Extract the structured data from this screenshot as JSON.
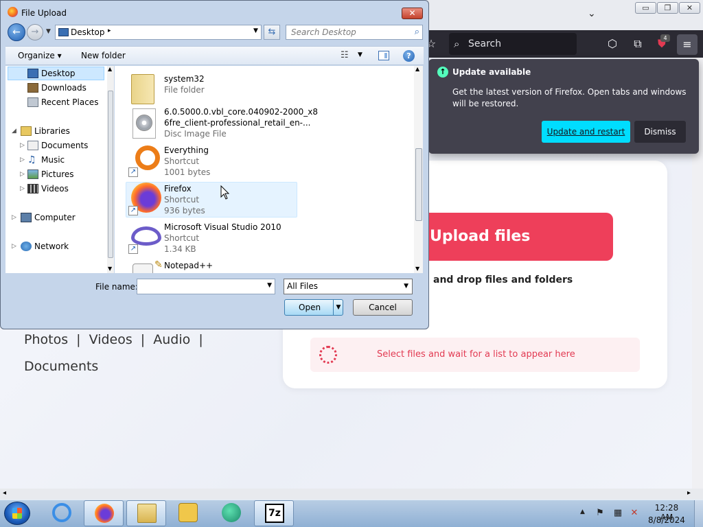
{
  "firefox": {
    "window_controls": {
      "minimize": "▭",
      "restore": "❐",
      "close": "✕"
    },
    "tab_list_chevron": "⌄",
    "search_placeholder": "Search",
    "extension_badge": "4",
    "update_popup": {
      "title": "Update available",
      "message": "Get the latest version of Firefox. Open tabs and windows will be restored.",
      "primary_button": "Update and restart",
      "secondary_button": "Dismiss",
      "accent_color": "#00ddff"
    },
    "page": {
      "upload_button": "Upload files",
      "drop_text": "and drop files and folders",
      "wait_text": "Select files and wait for a list to appear here",
      "media_links": [
        "Photos",
        "Videos",
        "Audio"
      ],
      "media_links_row2": "Documents",
      "separator": "|",
      "brand_color": "#ee3f5a"
    }
  },
  "dialog": {
    "title": "File Upload",
    "close_label": "✕",
    "address": {
      "location": "Desktop",
      "chevron": "▸"
    },
    "search_placeholder": "Search Desktop",
    "toolbar": {
      "organize": "Organize",
      "new_folder": "New folder",
      "help": "?"
    },
    "nav": [
      {
        "label": "Desktop",
        "icon": "desktop-icon",
        "selected": true
      },
      {
        "label": "Downloads",
        "icon": "downloads-icon"
      },
      {
        "label": "Recent Places",
        "icon": "recent-places-icon"
      },
      {
        "label": "Libraries",
        "icon": "libraries-icon"
      },
      {
        "label": "Documents",
        "icon": "documents-icon"
      },
      {
        "label": "Music",
        "icon": "music-icon"
      },
      {
        "label": "Pictures",
        "icon": "pictures-icon"
      },
      {
        "label": "Videos",
        "icon": "videos-icon"
      },
      {
        "label": "Computer",
        "icon": "computer-icon"
      },
      {
        "label": "Network",
        "icon": "network-icon"
      }
    ],
    "files": [
      {
        "name": "system32",
        "type": "File folder",
        "size": ""
      },
      {
        "name": "6.0.5000.0.vbl_core.040902-2000_x8",
        "name2": "6fre_client-professional_retail_en-...",
        "type": "Disc Image File",
        "size": ""
      },
      {
        "name": "Everything",
        "type": "Shortcut",
        "size": "1001 bytes"
      },
      {
        "name": "Firefox",
        "type": "Shortcut",
        "size": "936 bytes",
        "hovered": true
      },
      {
        "name": "Microsoft Visual Studio 2010",
        "type": "Shortcut",
        "size": "1.34 KB"
      },
      {
        "name": "Notepad++",
        "type": "",
        "size": ""
      }
    ],
    "file_name_label": "File name:",
    "file_name_value": "",
    "file_type": "All Files",
    "open_button": "Open",
    "cancel_button": "Cancel"
  },
  "taskbar": {
    "apps": [
      "internet-explorer-icon",
      "firefox-icon",
      "explorer-icon",
      "media-player-icon",
      "app-icon",
      "7zip-icon"
    ],
    "time": "12:28 AM",
    "date": "8/8/2024"
  }
}
